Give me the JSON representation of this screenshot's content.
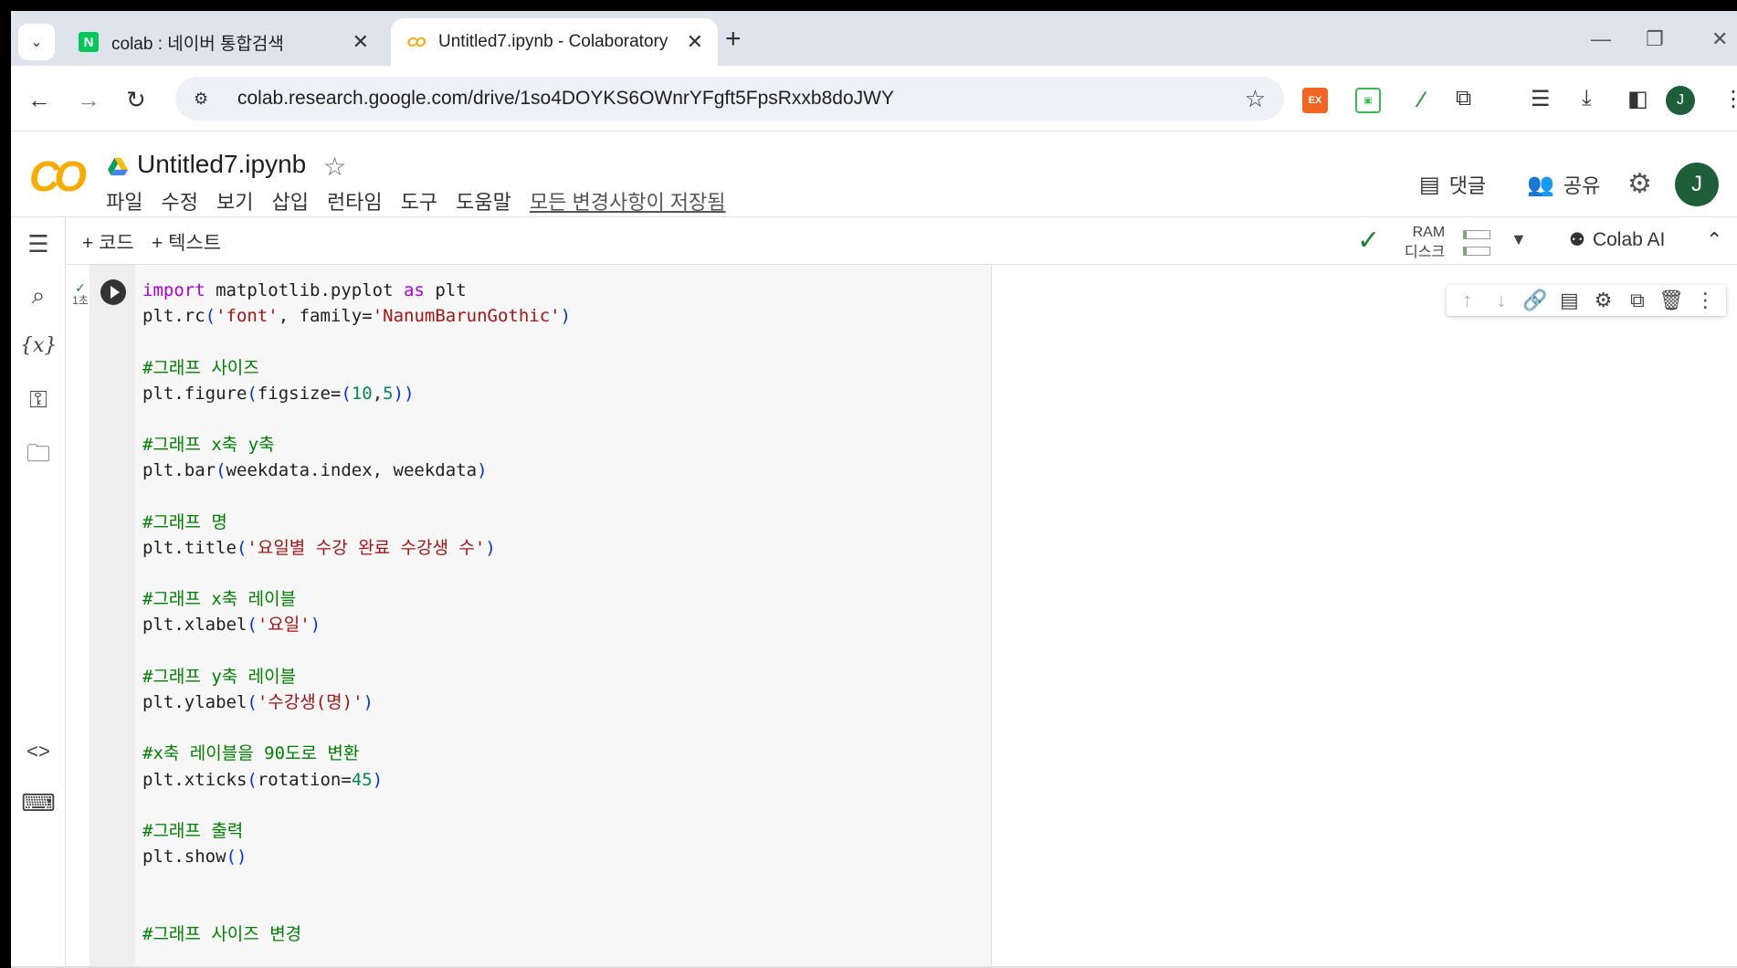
{
  "tabs": [
    {
      "label": "colab : 네이버 통합검색",
      "favicon": "N",
      "active": false
    },
    {
      "label": "Untitled7.ipynb - Colaboratory",
      "favicon": "CO",
      "active": true
    }
  ],
  "address": {
    "url": "colab.research.google.com/drive/1so4DOYKS6OWnrYFgft5FpsRxxb8doJWY"
  },
  "extensions": {
    "ex_label": "EX"
  },
  "profile": {
    "initial": "J"
  },
  "notebook": {
    "title": "Untitled7.ipynb",
    "menu": [
      "파일",
      "수정",
      "보기",
      "삽입",
      "런타임",
      "도구",
      "도움말"
    ],
    "saved_status": "모든 변경사항이 저장됨",
    "comment_label": "댓글",
    "share_label": "공유"
  },
  "cell_toolbar": {
    "add_code": "+ 코드",
    "add_text": "+ 텍스트",
    "ram_label": "RAM",
    "disk_label": "디스크",
    "ram_fraction": 0.1,
    "disk_fraction": 0.1,
    "colab_ai": "Colab AI"
  },
  "cell": {
    "status_time": "1초",
    "code_lines": [
      "import matplotlib.pyplot as plt",
      "plt.rc('font', family='NanumBarunGothic')",
      "",
      "#그래프 사이즈",
      "plt.figure(figsize=(10,5))",
      "",
      "#그래프 x축 y축",
      "plt.bar(weekdata.index, weekdata)",
      "",
      "#그래프 명",
      "plt.title('요일별 수강 완료 수강생 수')",
      "",
      "#그래프 x축 레이블",
      "plt.xlabel('요일')",
      "",
      "#그래프 y축 레이블",
      "plt.ylabel('수강생(명)')",
      "",
      "#x축 레이블을 90도로 변환",
      "plt.xticks(rotation=45)",
      "",
      "#그래프 출력",
      "plt.show()",
      "",
      "",
      "#그래프 사이즈 변경"
    ]
  },
  "colors": {
    "accent_green": "#188038",
    "colab_orange": "#f9ab00",
    "avatar_green": "#1e5f3a"
  }
}
